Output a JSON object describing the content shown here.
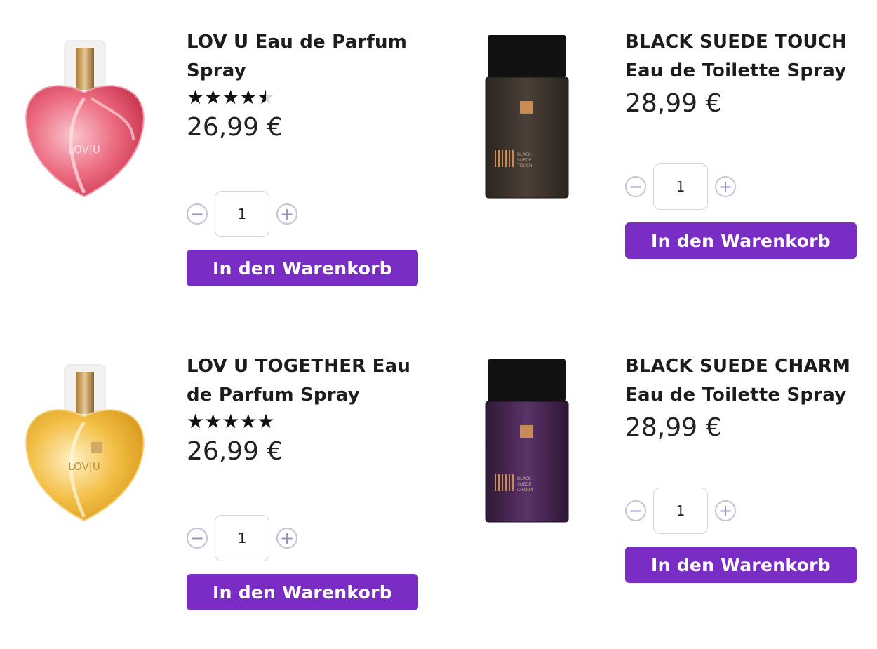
{
  "products": [
    {
      "name": "LOV U Eau de Parfum Spray",
      "rating": 4.5,
      "price": "26,99 €",
      "quantity": "1",
      "cart_label": "In den Warenkorb",
      "bottle_label": "LOV|U",
      "bottle_color": "#e8637a"
    },
    {
      "name": "BLACK SUEDE TOUCH Eau de Toilette Spray",
      "price": "28,99 €",
      "quantity": "1",
      "cart_label": "In den Warenkorb",
      "bottle_label": "BLACK SUEDE TOUCH",
      "bottle_color": "#3e3630"
    },
    {
      "name": "LOV U TOGETHER Eau de Parfum Spray",
      "rating": 5,
      "price": "26,99 €",
      "quantity": "1",
      "cart_label": "In den Warenkorb",
      "bottle_label": "LOV|U",
      "bottle_color": "#f0b73a"
    },
    {
      "name": "BLACK SUEDE CHARM Eau de Toilette Spray",
      "price": "28,99 €",
      "quantity": "1",
      "cart_label": "In den Warenkorb",
      "bottle_label": "BLACK SUEDE CHARM",
      "bottle_color": "#4a2a56"
    }
  ],
  "controls": {
    "minus_symbol": "−",
    "plus_symbol": "+",
    "star_glyphs": "★★★★★"
  },
  "colors": {
    "accent": "#7a2dc4",
    "stepper": "#a08cc0"
  }
}
